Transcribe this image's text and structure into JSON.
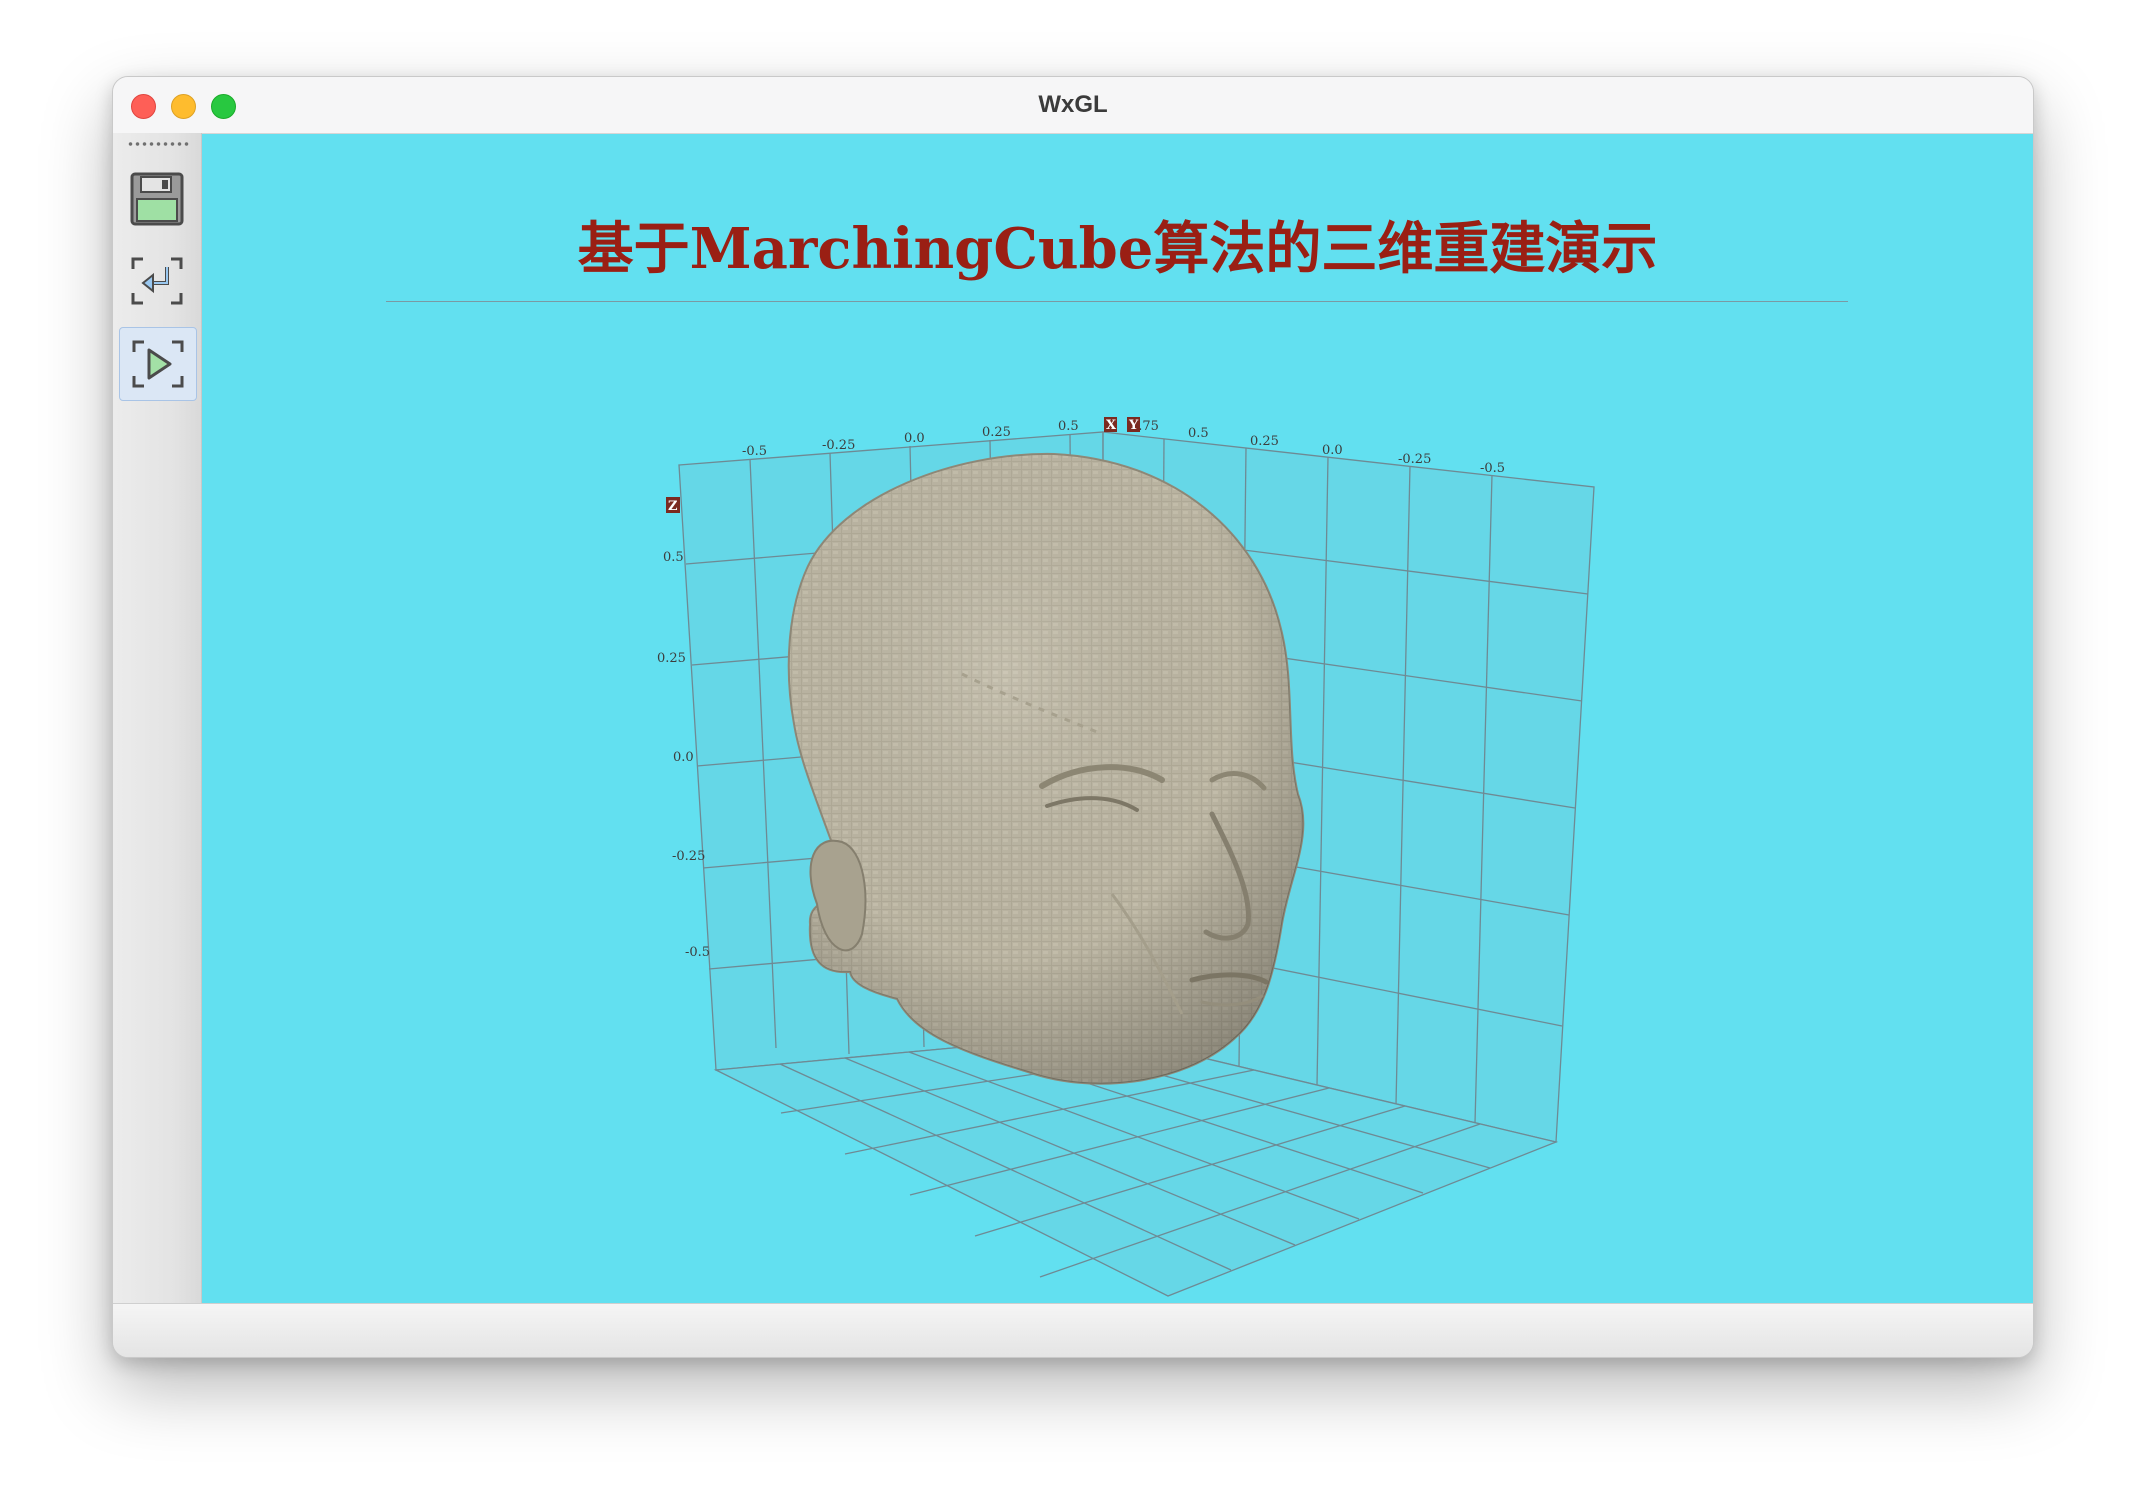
{
  "window": {
    "title": "WxGL"
  },
  "toolbar": {
    "buttons": [
      {
        "icon": "save-icon",
        "label": ""
      },
      {
        "icon": "restore-icon",
        "label": ""
      },
      {
        "icon": "play-icon",
        "label": "",
        "active": true
      }
    ]
  },
  "scene": {
    "title": "基于MarchingCube算法的三维重建演示",
    "background_color": "#62e0f0",
    "title_color": "#9a1f14",
    "mesh_color": "#b1ab98",
    "axes": {
      "x_label": "X",
      "y_label": "Y",
      "z_label": "Z",
      "x_ticks": [
        "-0.5",
        "-0.25",
        "0.0",
        "0.25",
        "0.5"
      ],
      "y_ticks": [
        "0.75",
        "0.5",
        "0.25",
        "0.0",
        "-0.25",
        "-0.5"
      ],
      "z_ticks": [
        "0.5",
        "0.25",
        "0.0",
        "-0.25",
        "-0.5"
      ]
    }
  }
}
